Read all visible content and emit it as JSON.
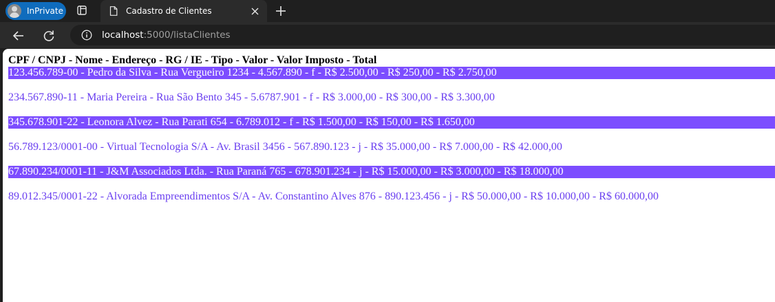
{
  "browser": {
    "inprivate_label": "InPrivate",
    "tab_title": "Cadastro de Clientes",
    "url_host": "localhost",
    "url_rest": ":5000/listaClientes"
  },
  "page": {
    "header": "CPF / CNPJ - Nome - Endereço - RG / IE - Tipo - Valor - Valor Imposto - Total",
    "rows": [
      "123.456.789-00 - Pedro da Silva - Rua Vergueiro 1234 - 4.567.890 - f - R$ 2.500,00 - R$ 250,00 - R$ 2.750,00",
      "234.567.890-11 - Maria Pereira - Rua São Bento 345 - 5.6787.901 - f - R$ 3.000,00 - R$ 300,00 - R$ 3.300,00",
      "345.678.901-22 - Leonora Alvez - Rua Parati 654 - 6.789.012 - f - R$ 1.500,00 - R$ 150,00 - R$ 1.650,00",
      "56.789.123/0001-00 - Virtual Tecnologia S/A - Av. Brasil 3456 - 567.890.123 - j - R$ 35.000,00 - R$ 7.000,00 - R$ 42.000,00",
      "67.890.234/0001-11 - J&M Associados Ltda. - Rua Paraná 765 - 678.901.234 - j - R$ 15.000,00 - R$ 3.000,00 - R$ 18.000,00",
      "89.012.345/0001-22 - Alvorada Empreendimentos S/A - Av. Constantino Alves 876 - 890.123.456 - j - R$ 50.000,00 - R$ 10.000,00 - R$ 60.000,00"
    ]
  },
  "colors": {
    "highlight_row_bg": "#7c4dff",
    "highlight_row_text": "#ffffff",
    "plain_row_text": "#6a3ff0",
    "inprivate_badge": "#0f6cbd"
  },
  "icons": {
    "profile": "avatar-icon",
    "tab_actions": "tab-actions-icon",
    "page": "page-icon",
    "close": "close-icon",
    "new_tab": "plus-icon",
    "back": "back-arrow-icon",
    "reload": "reload-icon",
    "site_info": "info-icon"
  }
}
